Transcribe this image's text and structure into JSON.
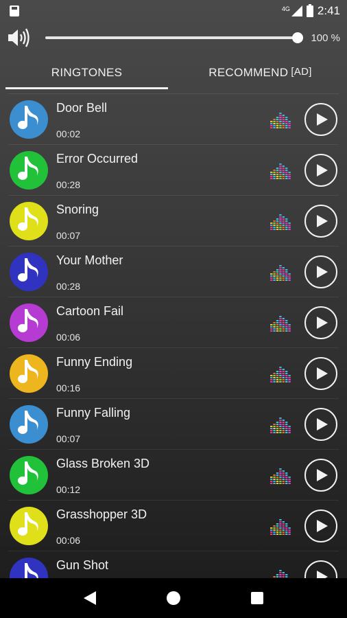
{
  "status_bar": {
    "network": "4G",
    "time": "2:41"
  },
  "volume": {
    "value_label": "100 %",
    "level": 1.0
  },
  "tabs": [
    {
      "label": "RINGTONES",
      "active": true
    },
    {
      "label": "RECOMMEND",
      "ad": "[AD]",
      "active": false
    }
  ],
  "ringtones": [
    {
      "title": "Door Bell",
      "duration": "00:02",
      "color": "#3b8fd0"
    },
    {
      "title": "Error Occurred",
      "duration": "00:28",
      "color": "#21c13a"
    },
    {
      "title": "Snoring",
      "duration": "00:07",
      "color": "#dfe019"
    },
    {
      "title": "Your Mother",
      "duration": "00:28",
      "color": "#2f33bf"
    },
    {
      "title": "Cartoon Fail",
      "duration": "00:06",
      "color": "#b53bd2"
    },
    {
      "title": "Funny Ending",
      "duration": "00:16",
      "color": "#eeb61e"
    },
    {
      "title": "Funny Falling",
      "duration": "00:07",
      "color": "#3b8fd0"
    },
    {
      "title": "Glass Broken 3D",
      "duration": "00:12",
      "color": "#21c13a"
    },
    {
      "title": "Grasshopper 3D",
      "duration": "00:06",
      "color": "#dfe019"
    },
    {
      "title": "Gun Shot",
      "duration": "",
      "color": "#2f33bf"
    }
  ],
  "icons": {
    "status_sd": "sd-card-icon",
    "signal": "signal-icon",
    "battery": "battery-charging-icon",
    "speaker": "speaker-icon",
    "note": "music-note-icon",
    "equalizer": "equalizer-icon",
    "play": "play-icon",
    "nav_back": "back-icon",
    "nav_home": "home-icon",
    "nav_recent": "recent-apps-icon"
  }
}
